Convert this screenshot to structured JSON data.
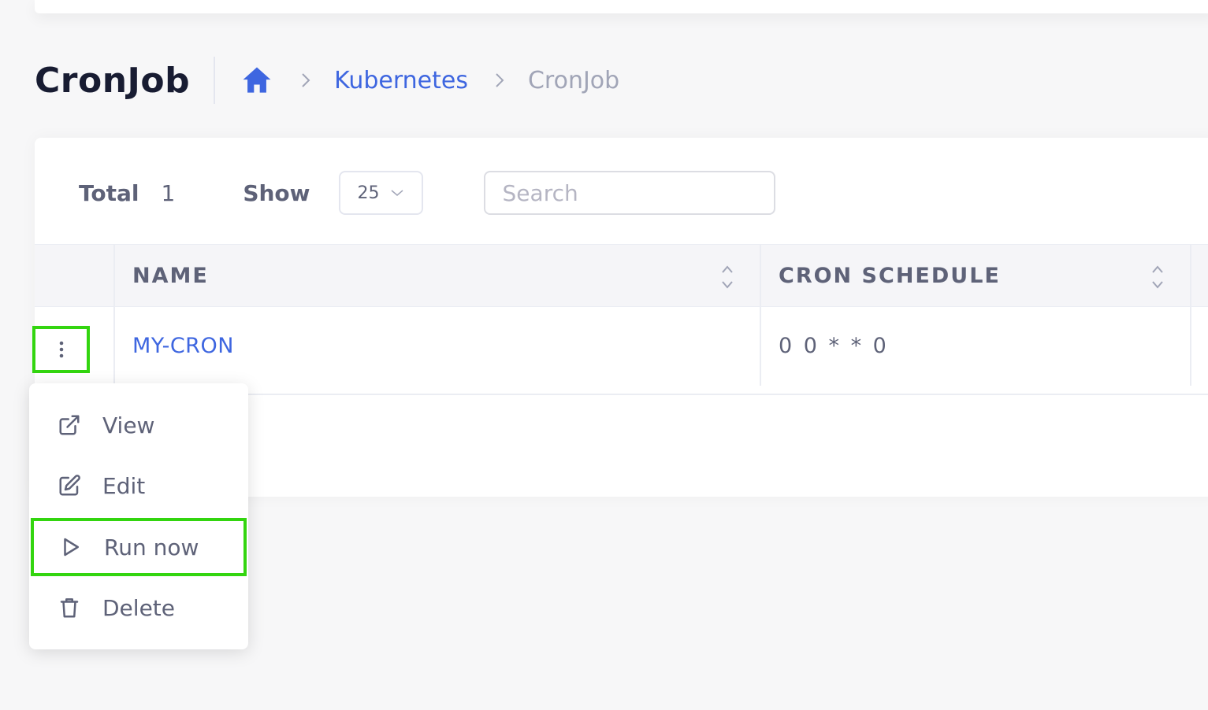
{
  "page": {
    "title": "CronJob"
  },
  "breadcrumb": {
    "home_icon": "home-icon",
    "items": [
      {
        "label": "Kubernetes"
      },
      {
        "label": "CronJob"
      }
    ]
  },
  "toolbar": {
    "total_label": "Total",
    "total_value": "1",
    "show_label": "Show",
    "page_size": "25",
    "search_placeholder": "Search"
  },
  "table": {
    "columns": [
      {
        "label": "NAME"
      },
      {
        "label": "CRON SCHEDULE"
      }
    ],
    "rows": [
      {
        "name": "MY-CRON",
        "cron_schedule": "0 0 * * 0"
      }
    ]
  },
  "row_menu": {
    "items": [
      {
        "label": "View",
        "icon": "external-link-icon"
      },
      {
        "label": "Edit",
        "icon": "edit-icon"
      },
      {
        "label": "Run now",
        "icon": "play-icon"
      },
      {
        "label": "Delete",
        "icon": "trash-icon"
      }
    ]
  },
  "colors": {
    "accent": "#3e66e0",
    "highlight": "#33d50f",
    "muted": "#a1a5b7"
  }
}
